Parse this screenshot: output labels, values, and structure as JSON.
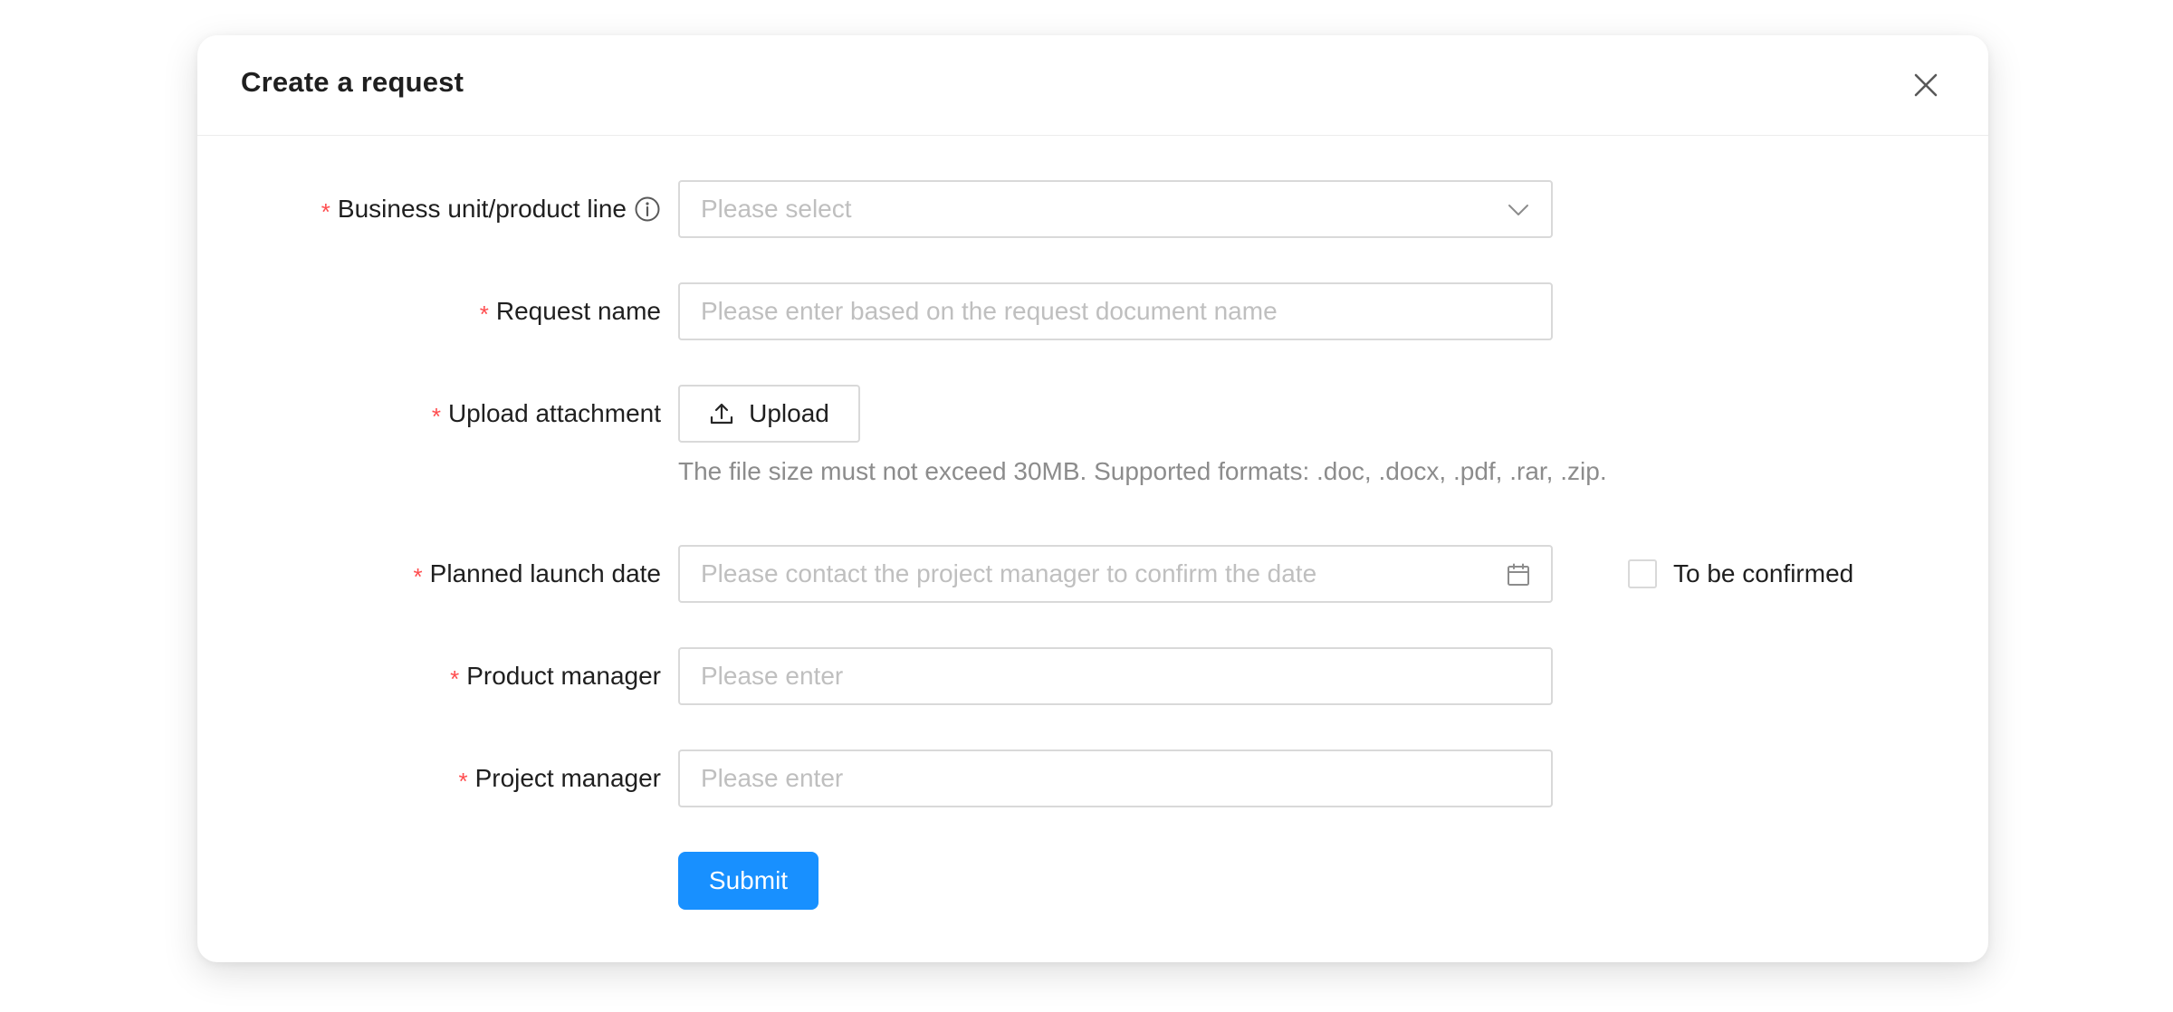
{
  "modal": {
    "title": "Create a request"
  },
  "form": {
    "business_unit": {
      "required": "*",
      "label": "Business unit/product line",
      "placeholder": "Please select"
    },
    "request_name": {
      "required": "*",
      "label": "Request name",
      "placeholder": "Please enter based on the request document name"
    },
    "upload": {
      "required": "*",
      "label": "Upload attachment",
      "button_label": "Upload",
      "hint": "The file size must not exceed 30MB. Supported formats: .doc, .docx, .pdf, .rar, .zip."
    },
    "launch_date": {
      "required": "*",
      "label": "Planned launch date",
      "placeholder": "Please contact the project manager to confirm the date",
      "checkbox_label": "To be confirmed",
      "checkbox_checked": false
    },
    "product_manager": {
      "required": "*",
      "label": "Product manager",
      "placeholder": "Please enter"
    },
    "project_manager": {
      "required": "*",
      "label": "Project manager",
      "placeholder": "Please enter"
    },
    "submit_label": "Submit"
  },
  "colors": {
    "primary": "#1890ff",
    "required": "#ff4d4f",
    "border": "#d9d9d9",
    "placeholder": "#bfbfbf",
    "hint": "#8c8c8c"
  },
  "icons": {
    "close": "close-icon",
    "info": "info-icon",
    "dropdown": "chevron-down-icon",
    "upload": "upload-icon",
    "calendar": "calendar-icon"
  }
}
